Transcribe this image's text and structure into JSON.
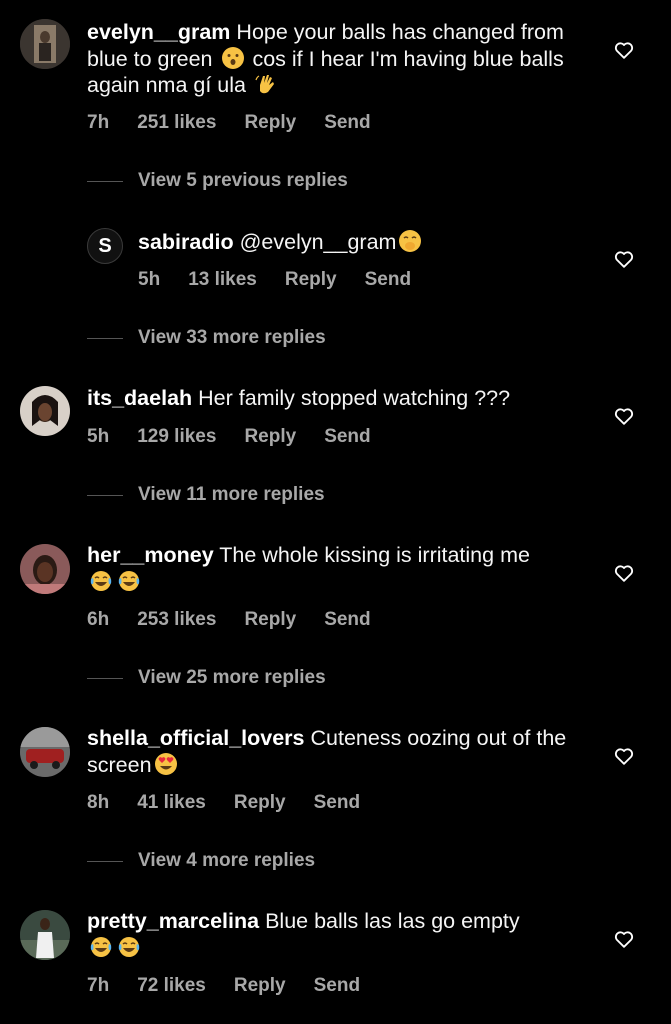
{
  "colors": {
    "background": "#000000",
    "text": "#f5f5f5",
    "meta": "#a8a8a8",
    "divider": "#555555"
  },
  "comments": [
    {
      "username": "evelyn__gram",
      "text_parts": [
        "Hope your balls has changed from blue to green ",
        " cos if I hear I'm having blue balls again nma gí ula "
      ],
      "emojis": [
        "hushed-face-emoji",
        "waving-hand-emoji"
      ],
      "time": "7h",
      "likes": "251 likes",
      "reply": "Reply",
      "send": "Send",
      "view_replies": "View 5 previous replies"
    },
    {
      "username": "sabiradio",
      "avatar_letter": "S",
      "text": "@evelyn__gram",
      "emojis": [
        "face-with-hand-over-mouth-emoji"
      ],
      "time": "5h",
      "likes": "13 likes",
      "reply": "Reply",
      "send": "Send",
      "view_replies": "View 33 more replies"
    },
    {
      "username": "its_daelah",
      "text": "Her family stopped watching ???",
      "time": "5h",
      "likes": "129 likes",
      "reply": "Reply",
      "send": "Send",
      "view_replies": "View 11 more replies"
    },
    {
      "username": "her__money",
      "text": "The whole kissing is irritating me",
      "emojis": [
        "tears-of-joy-emoji",
        "tears-of-joy-emoji"
      ],
      "time": "6h",
      "likes": "253 likes",
      "reply": "Reply",
      "send": "Send",
      "view_replies": "View 25 more replies"
    },
    {
      "username": "shella_official_lovers",
      "text_parts": [
        "Cuteness oozing out of the screen"
      ],
      "emojis": [
        "heart-eyes-emoji"
      ],
      "time": "8h",
      "likes": "41 likes",
      "reply": "Reply",
      "send": "Send",
      "view_replies": "View 4 more replies"
    },
    {
      "username": "pretty_marcelina",
      "text": "Blue balls las las go empty",
      "emojis": [
        "tears-of-joy-emoji",
        "tears-of-joy-emoji"
      ],
      "time": "7h",
      "likes": "72 likes",
      "reply": "Reply",
      "send": "Send"
    }
  ]
}
